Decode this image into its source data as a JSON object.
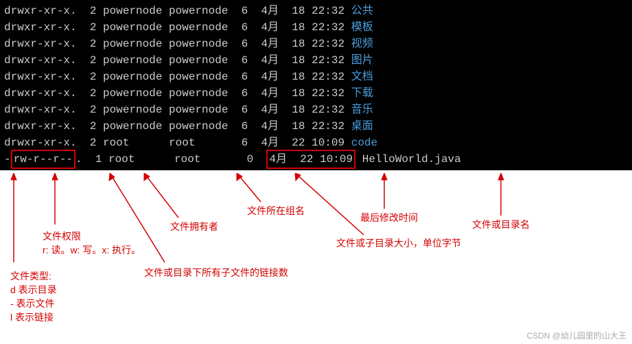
{
  "terminal": {
    "rows": [
      {
        "perms": "drwxr-xr-x.",
        "links": "2",
        "owner": "powernode",
        "group": "powernode",
        "size": "6",
        "date": " 4月  18 22:32",
        "name": "公共",
        "type": "dir"
      },
      {
        "perms": "drwxr-xr-x.",
        "links": "2",
        "owner": "powernode",
        "group": "powernode",
        "size": "6",
        "date": " 4月  18 22:32",
        "name": "模板",
        "type": "dir"
      },
      {
        "perms": "drwxr-xr-x.",
        "links": "2",
        "owner": "powernode",
        "group": "powernode",
        "size": "6",
        "date": " 4月  18 22:32",
        "name": "视频",
        "type": "dir"
      },
      {
        "perms": "drwxr-xr-x.",
        "links": "2",
        "owner": "powernode",
        "group": "powernode",
        "size": "6",
        "date": " 4月  18 22:32",
        "name": "图片",
        "type": "dir"
      },
      {
        "perms": "drwxr-xr-x.",
        "links": "2",
        "owner": "powernode",
        "group": "powernode",
        "size": "6",
        "date": " 4月  18 22:32",
        "name": "文档",
        "type": "dir"
      },
      {
        "perms": "drwxr-xr-x.",
        "links": "2",
        "owner": "powernode",
        "group": "powernode",
        "size": "6",
        "date": " 4月  18 22:32",
        "name": "下载",
        "type": "dir"
      },
      {
        "perms": "drwxr-xr-x.",
        "links": "2",
        "owner": "powernode",
        "group": "powernode",
        "size": "6",
        "date": " 4月  18 22:32",
        "name": "音乐",
        "type": "dir"
      },
      {
        "perms": "drwxr-xr-x.",
        "links": "2",
        "owner": "powernode",
        "group": "powernode",
        "size": "6",
        "date": " 4月  18 22:32",
        "name": "桌面",
        "type": "dir"
      },
      {
        "perms": "drwxr-xr-x.",
        "links": "2",
        "owner": "root",
        "group": "root",
        "size": "6",
        "date": " 4月  22 10:09",
        "name": "code",
        "type": "dir"
      }
    ],
    "highlighted": {
      "type_char": "-",
      "perms": "rw-r--r--",
      "dot": ".",
      "links": "1",
      "owner": "root",
      "group": "root",
      "size": "0",
      "date": "4月  22 10:09",
      "name": "HelloWorld.java"
    }
  },
  "annotations": {
    "file_type": "文件类型:\nd 表示目录\n- 表示文件\nl 表示链接",
    "file_perm": "文件权限\nr: 读。w: 写。x: 执行。",
    "link_count": "文件或目录下所有子文件的链接数",
    "owner": "文件拥有者",
    "group": "文件所在组名",
    "size": "文件或子目录大小，单位字节",
    "mtime": "最后修改时间",
    "name": "文件或目录名"
  },
  "watermark": "CSDN @幼儿园里的山大王"
}
